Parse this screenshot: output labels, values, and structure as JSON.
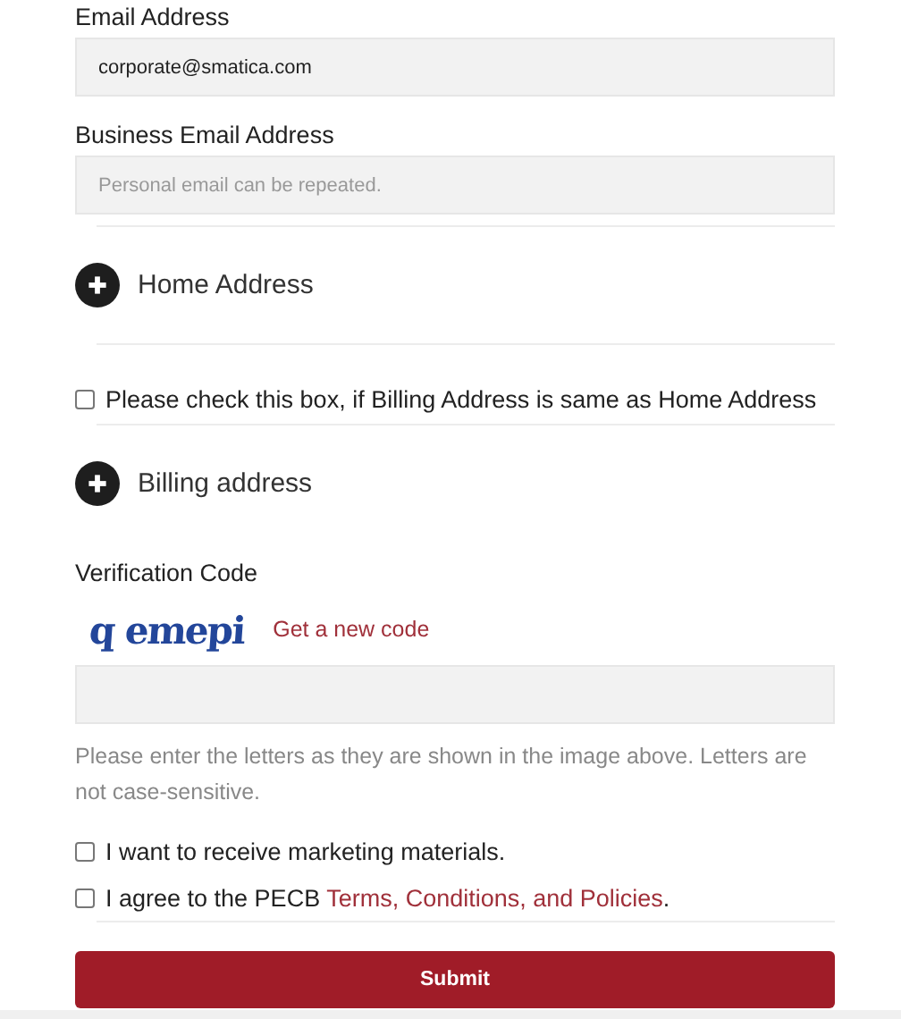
{
  "fields_top": [
    {
      "label": "Email Address",
      "value": "corporate@smatica.com"
    },
    {
      "label": "Business Email Address",
      "placeholder": "Personal email can be repeated."
    }
  ],
  "home_section": {
    "title": "Home Address",
    "expanded": false
  },
  "same_address": {
    "text": "Please check this box, if Billing Address is same as Home Address",
    "checked": false
  },
  "billing_section": {
    "title": "Billing address",
    "expanded": false
  },
  "verification": {
    "label": "Verification Code",
    "captcha": "q emepi",
    "new_code_link": "Get a new code",
    "help": "Please enter the letters as they are shown in the image above. Letters are not case-sensitive."
  },
  "consents": [
    {
      "text": "I want to receive marketing materials.",
      "checked": false
    },
    {
      "text": "I agree to the PECB ",
      "link": "Terms, Conditions, and Policies",
      "after": ".",
      "checked": false
    }
  ],
  "submit": "Submit"
}
